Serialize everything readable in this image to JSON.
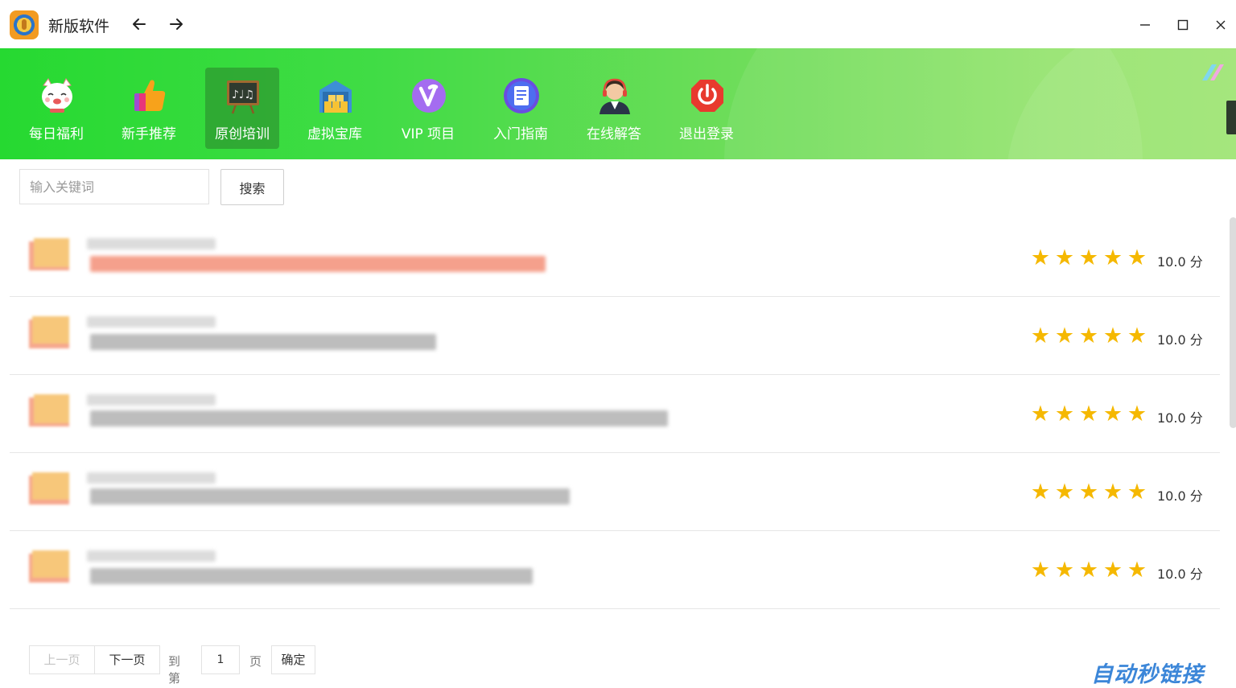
{
  "window": {
    "title": "新版软件",
    "back_icon": "arrow-left-icon",
    "forward_icon": "arrow-right-icon",
    "minimize": "—",
    "maximize": "☐",
    "close": "✕"
  },
  "nav": {
    "items": [
      {
        "label": "每日福利",
        "icon": "lucky-cat-icon",
        "active": false
      },
      {
        "label": "新手推荐",
        "icon": "thumbs-up-icon",
        "active": false
      },
      {
        "label": "原创培训",
        "icon": "chalkboard-icon",
        "active": true
      },
      {
        "label": "虚拟宝库",
        "icon": "treasure-warehouse-icon",
        "active": false
      },
      {
        "label": "VIP 项目",
        "icon": "vip-badge-icon",
        "active": false
      },
      {
        "label": "入门指南",
        "icon": "document-guide-icon",
        "active": false
      },
      {
        "label": "在线解答",
        "icon": "customer-service-icon",
        "active": false
      },
      {
        "label": "退出登录",
        "icon": "power-icon",
        "active": false
      }
    ]
  },
  "search": {
    "placeholder": "输入关键词",
    "button_label": "搜索"
  },
  "list": {
    "rows": [
      {
        "rating": 5,
        "score": "10.0 分",
        "title_color": "#f18a74"
      },
      {
        "rating": 5,
        "score": "10.0 分",
        "title_color": "#b8b8b8"
      },
      {
        "rating": 5,
        "score": "10.0 分",
        "title_color": "#b8b8b8"
      },
      {
        "rating": 5,
        "score": "10.0 分",
        "title_color": "#b8b8b8"
      },
      {
        "rating": 5,
        "score": "10.0 分",
        "title_color": "#b8b8b8"
      }
    ],
    "star_color": "#f5b800"
  },
  "pagination": {
    "prev_label": "上一页",
    "next_label": "下一页",
    "goto_label": "到第",
    "page_value": "1",
    "page_unit": "页",
    "confirm_label": "确定"
  },
  "watermark": "自动秒链接",
  "colors": {
    "header_start": "#26d931",
    "header_end": "#9ee472",
    "active_nav": "#2e7a2e"
  }
}
